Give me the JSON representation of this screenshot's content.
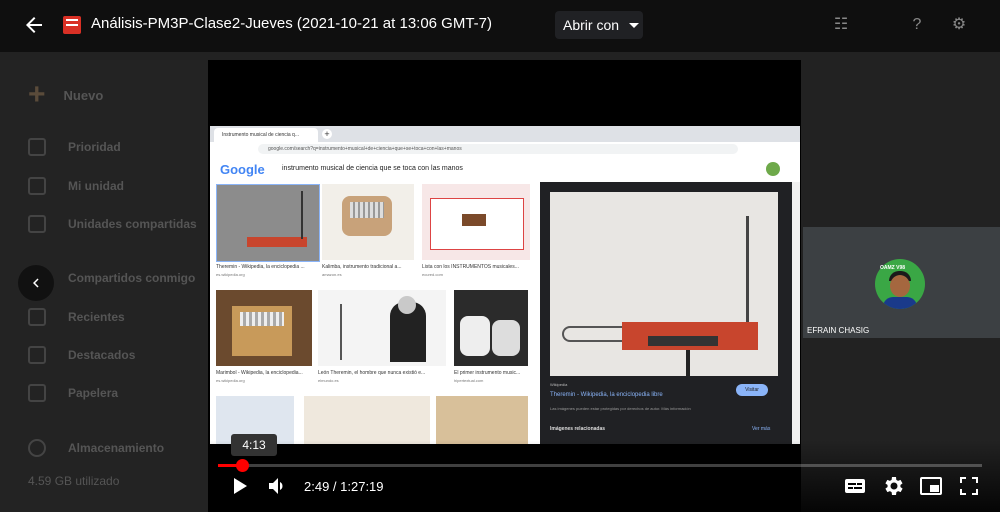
{
  "window": {
    "file_title": "Análisis-PM3P-Clase2-Jueves (2021-10-21 at 13:06 GMT-7)",
    "open_with_label": "Abrir con"
  },
  "drive_sidebar": {
    "new_label": "Nuevo",
    "items": [
      "Prioridad",
      "Mi unidad",
      "Unidades compartidas",
      "Compartidos conmigo",
      "Recientes",
      "Destacados",
      "Papelera"
    ],
    "storage_label": "Almacenamiento",
    "storage_used": "4.59 GB utilizado"
  },
  "browser": {
    "tab_title": "Instrumento musical de ciencia q...",
    "url": "google.com/search?q=instrumento+musical+de+ciencia+que+se+toca+con+las+manos",
    "logo": "Google",
    "query": "instrumento musical de ciencia que se toca con las manos",
    "results": [
      {
        "caption": "Theremin - Wikipedia, la enciclopedia ...",
        "source": "es.wikipedia.org"
      },
      {
        "caption": "Kalimba, instrumento tradicional a...",
        "source": "amazon.es"
      },
      {
        "caption": "Lista con los INSTRUMENTOS musicales...",
        "source": "ecured.com"
      },
      {
        "caption": "Marimbol - Wikipedia, la enciclopedia...",
        "source": "es.wikipedia.org"
      },
      {
        "caption": "León Theremin, el hombre que nunca existió e...",
        "source": "elmundo.es"
      },
      {
        "caption": "El primer instrumento music...",
        "source": "hipertextual.com"
      }
    ],
    "panel": {
      "source": "Wikipedia",
      "title": "Theremin - Wikipedia, la enciclopedia libre",
      "visit_label": "Visitar",
      "note": "Las imágenes pueden estar protegidas por derechos de autor. Más información",
      "related_label": "Imágenes relacionadas",
      "more_label": "Ver más"
    }
  },
  "participant": {
    "name": "EFRAIN CHASIG",
    "badge": "OAMZ V98"
  },
  "player": {
    "tooltip_time": "4:13",
    "time_display": "2:49 / 1:27:19",
    "progress": 0.032
  },
  "colors": {
    "progress": "#ff0000",
    "file_icon": "#d93025",
    "avatar_bg": "#3aa745"
  }
}
